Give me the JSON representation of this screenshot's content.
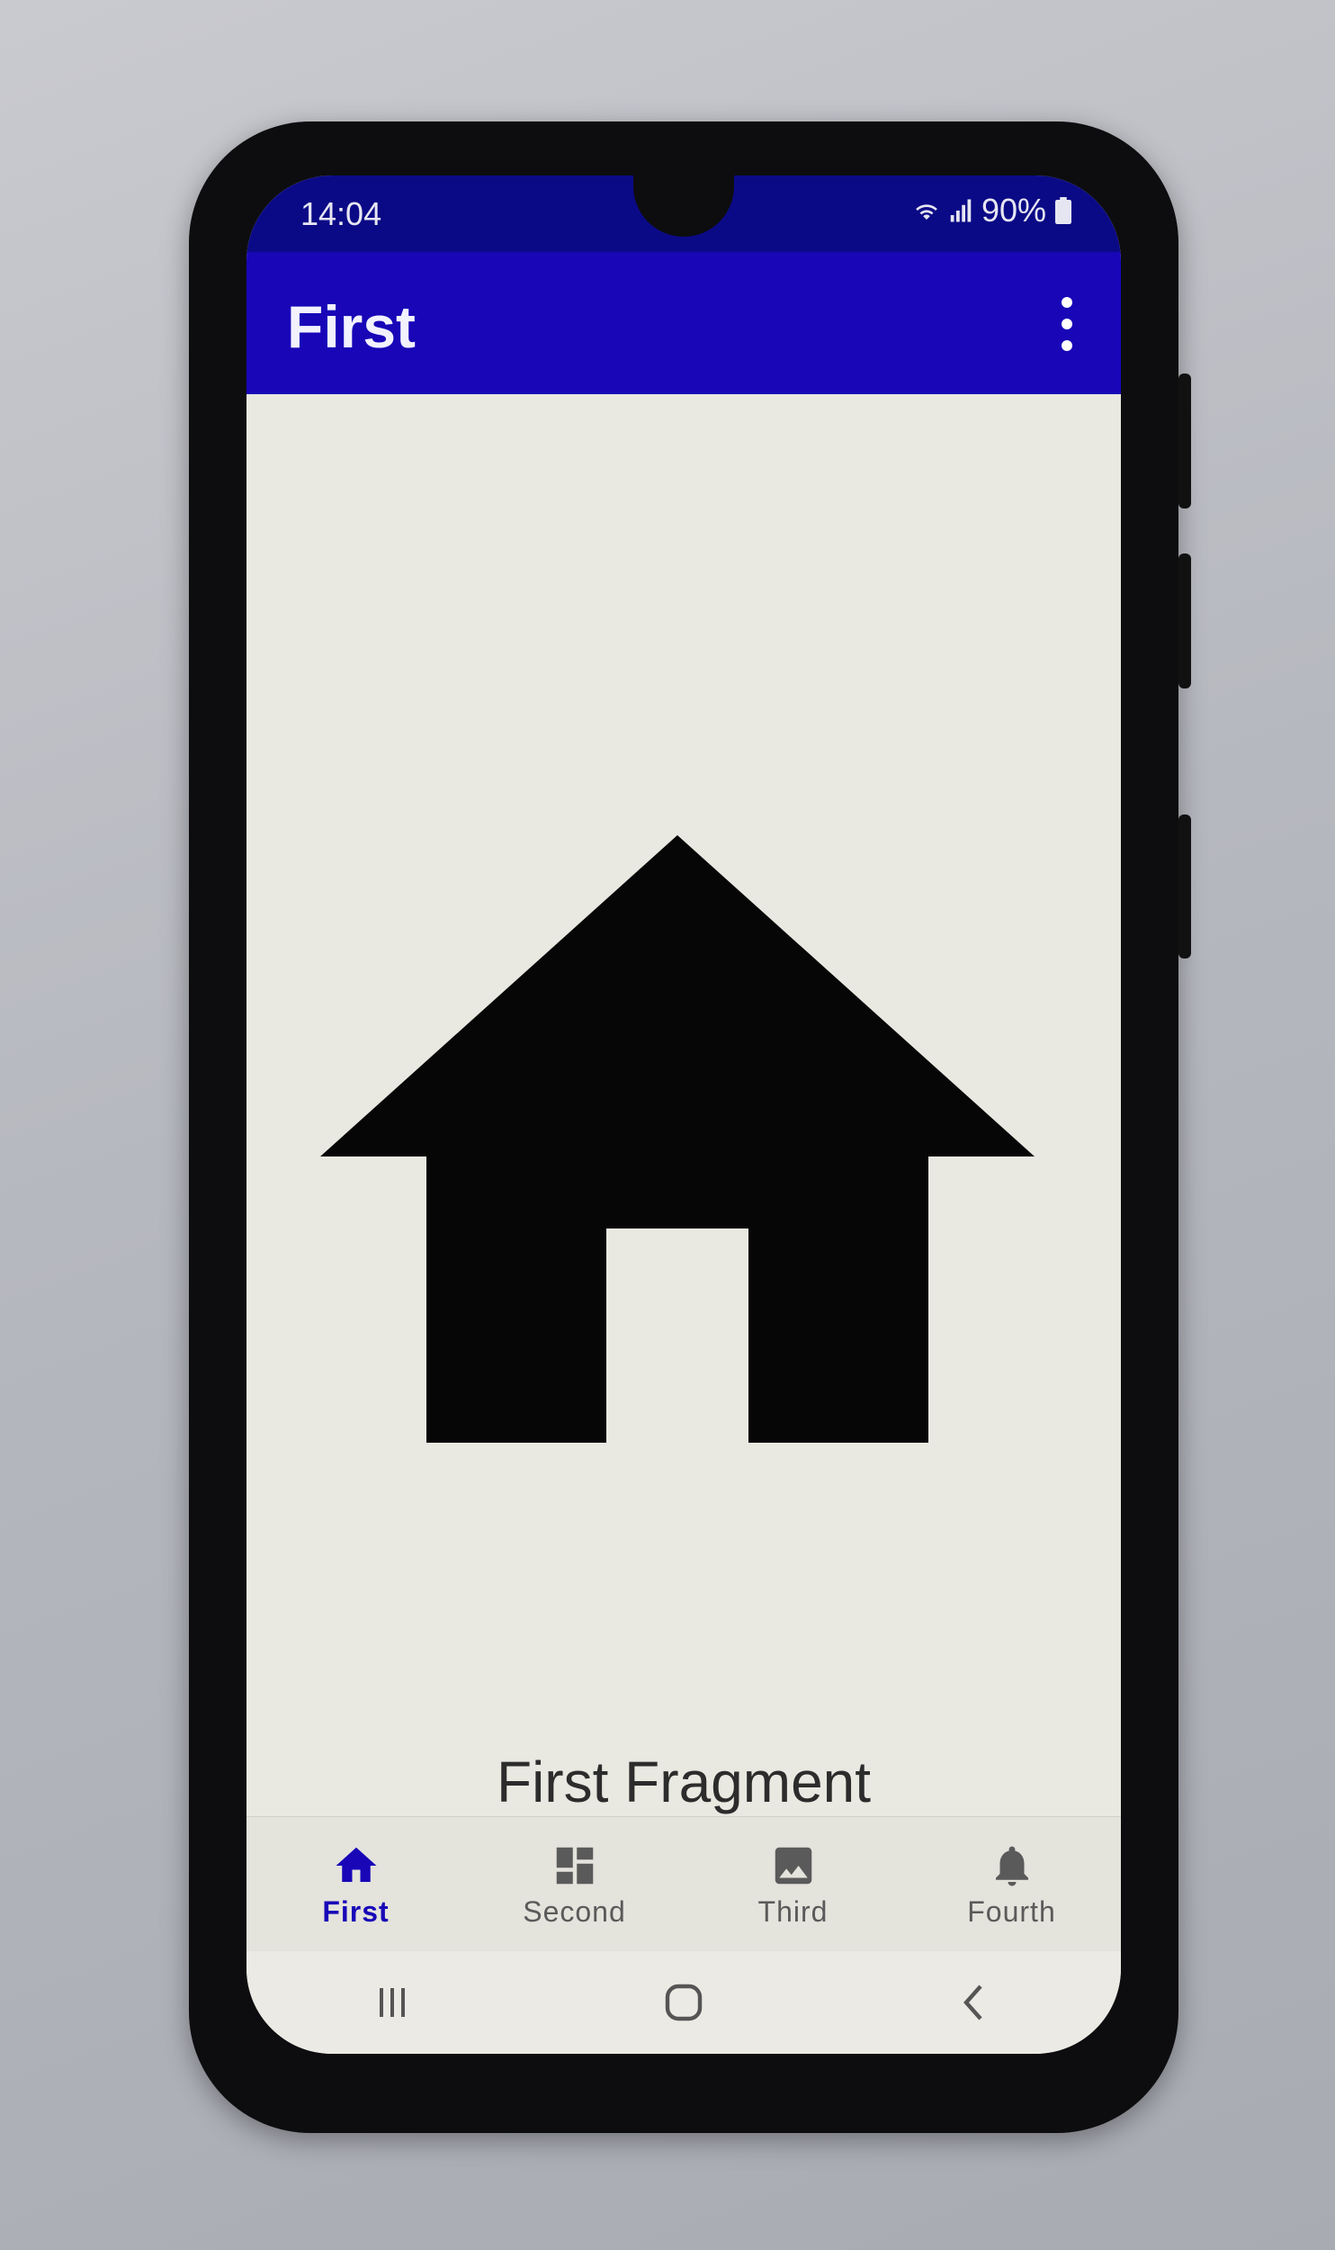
{
  "status_bar": {
    "time": "14:04",
    "battery": "90%",
    "icons": [
      "wifi-icon",
      "signal-icon",
      "battery-icon"
    ]
  },
  "app_bar": {
    "title": "First",
    "menu_icon": "more-vert-icon"
  },
  "content": {
    "image_icon": "house-icon",
    "label": "First Fragment"
  },
  "bottom_nav": {
    "items": [
      {
        "label": "First",
        "icon": "home-icon",
        "active": true
      },
      {
        "label": "Second",
        "icon": "dashboard-icon",
        "active": false
      },
      {
        "label": "Third",
        "icon": "image-icon",
        "active": false
      },
      {
        "label": "Fourth",
        "icon": "bell-icon",
        "active": false
      }
    ]
  },
  "system_nav": {
    "icons": [
      "recents-icon",
      "home-circle-icon",
      "back-icon"
    ]
  },
  "colors": {
    "status_bar": "#0b0a86",
    "app_bar": "#1806b7",
    "accent": "#1806b7",
    "screen_bg": "#e9e8e1"
  }
}
